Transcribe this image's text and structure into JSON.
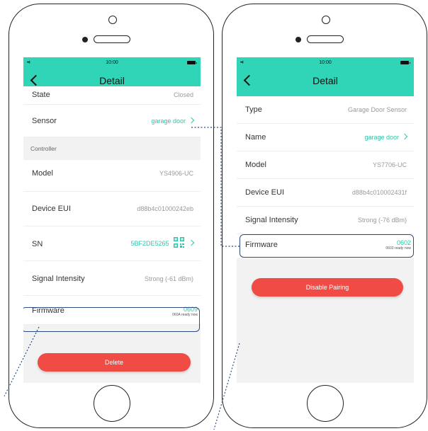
{
  "left": {
    "status_time": "10:00",
    "signal_text": "•••l",
    "nav_title": "Detail",
    "partial_label": "State",
    "partial_value": "Closed",
    "sensor_label": "Sensor",
    "sensor_value": "garage door",
    "controller_header": "Controller",
    "model_label": "Model",
    "model_value": "YS4906-UC",
    "eui_label": "Device EUI",
    "eui_value": "d88b4c01000242eb",
    "sn_label": "SN",
    "sn_value": "5BF2DE5265",
    "signal_label": "Signal Intensity",
    "signal_value": "Strong (-61 dBm)",
    "firmware_label": "Firmware",
    "firmware_version": "0609",
    "firmware_ready": "060A ready now",
    "delete_label": "Delete"
  },
  "right": {
    "status_time": "10:00",
    "signal_text": "•••l",
    "nav_title": "Detail",
    "type_label": "Type",
    "type_value": "Garage Door Sensor",
    "name_label": "Name",
    "name_value": "garage door",
    "model_label": "Model",
    "model_value": "YS7706-UC",
    "eui_label": "Device EUI",
    "eui_value": "d88b4c010002431f",
    "signal_label": "Signal Intensity",
    "signal_value": "Strong (-76 dBm)",
    "firmware_label": "Firmware",
    "firmware_version": "0602",
    "firmware_ready": "0603 ready now",
    "disable_label": "Disable Pairing"
  },
  "colors": {
    "header": "#2fd5b6",
    "accent": "#2fc5a8",
    "button": "#f04b45",
    "highlight": "#2c4d7e"
  },
  "icons": [
    "back-chevron-icon",
    "chevron-right-icon",
    "qr-code-icon",
    "battery-icon",
    "signal-icon"
  ]
}
